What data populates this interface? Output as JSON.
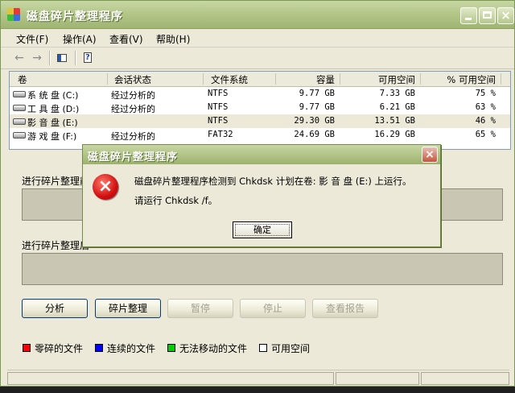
{
  "app": {
    "title": "磁盘碎片整理程序"
  },
  "menu": [
    "文件(F)",
    "操作(A)",
    "查看(V)",
    "帮助(H)"
  ],
  "toolbar": {
    "back_icon": "←",
    "forward_icon": "→"
  },
  "columns": [
    "卷",
    "会话状态",
    "文件系统",
    "容量",
    "可用空间",
    "% 可用空间"
  ],
  "volumes": [
    {
      "name": "系 统 盘 (C:)",
      "status": "经过分析的",
      "fs": "NTFS",
      "capacity": "9.77 GB",
      "free": "7.33 GB",
      "pct": "75 %"
    },
    {
      "name": "工 具 盘 (D:)",
      "status": "经过分析的",
      "fs": "NTFS",
      "capacity": "9.77 GB",
      "free": "6.21 GB",
      "pct": "63 %"
    },
    {
      "name": "影 音 盘 (E:)",
      "status": "",
      "fs": "NTFS",
      "capacity": "29.30 GB",
      "free": "13.51 GB",
      "pct": "46 %"
    },
    {
      "name": "游 戏 盘 (F:)",
      "status": "经过分析的",
      "fs": "FAT32",
      "capacity": "24.69 GB",
      "free": "16.29 GB",
      "pct": "65 %"
    }
  ],
  "pane": {
    "label1": "进行碎片整理前",
    "label2": "进行碎片整理后"
  },
  "buttons": [
    "分析",
    "碎片整理",
    "暂停",
    "停止",
    "查看报告"
  ],
  "legend": [
    {
      "label": "零碎的文件",
      "color": "#ff0000"
    },
    {
      "label": "连续的文件",
      "color": "#0000ff"
    },
    {
      "label": "无法移动的文件",
      "color": "#00cc00"
    },
    {
      "label": "可用空间",
      "color": "#ffffff"
    }
  ],
  "dialog": {
    "title": "磁盘碎片整理程序",
    "message1": "磁盘碎片整理程序检测到 Chkdsk 计划在卷: 影 音 盘 (E:) 上运行。",
    "message2": "请运行 Chkdsk /f。",
    "ok_label": "确定",
    "close": "×",
    "icon": "×"
  },
  "window_buttons": {
    "close": "×"
  }
}
